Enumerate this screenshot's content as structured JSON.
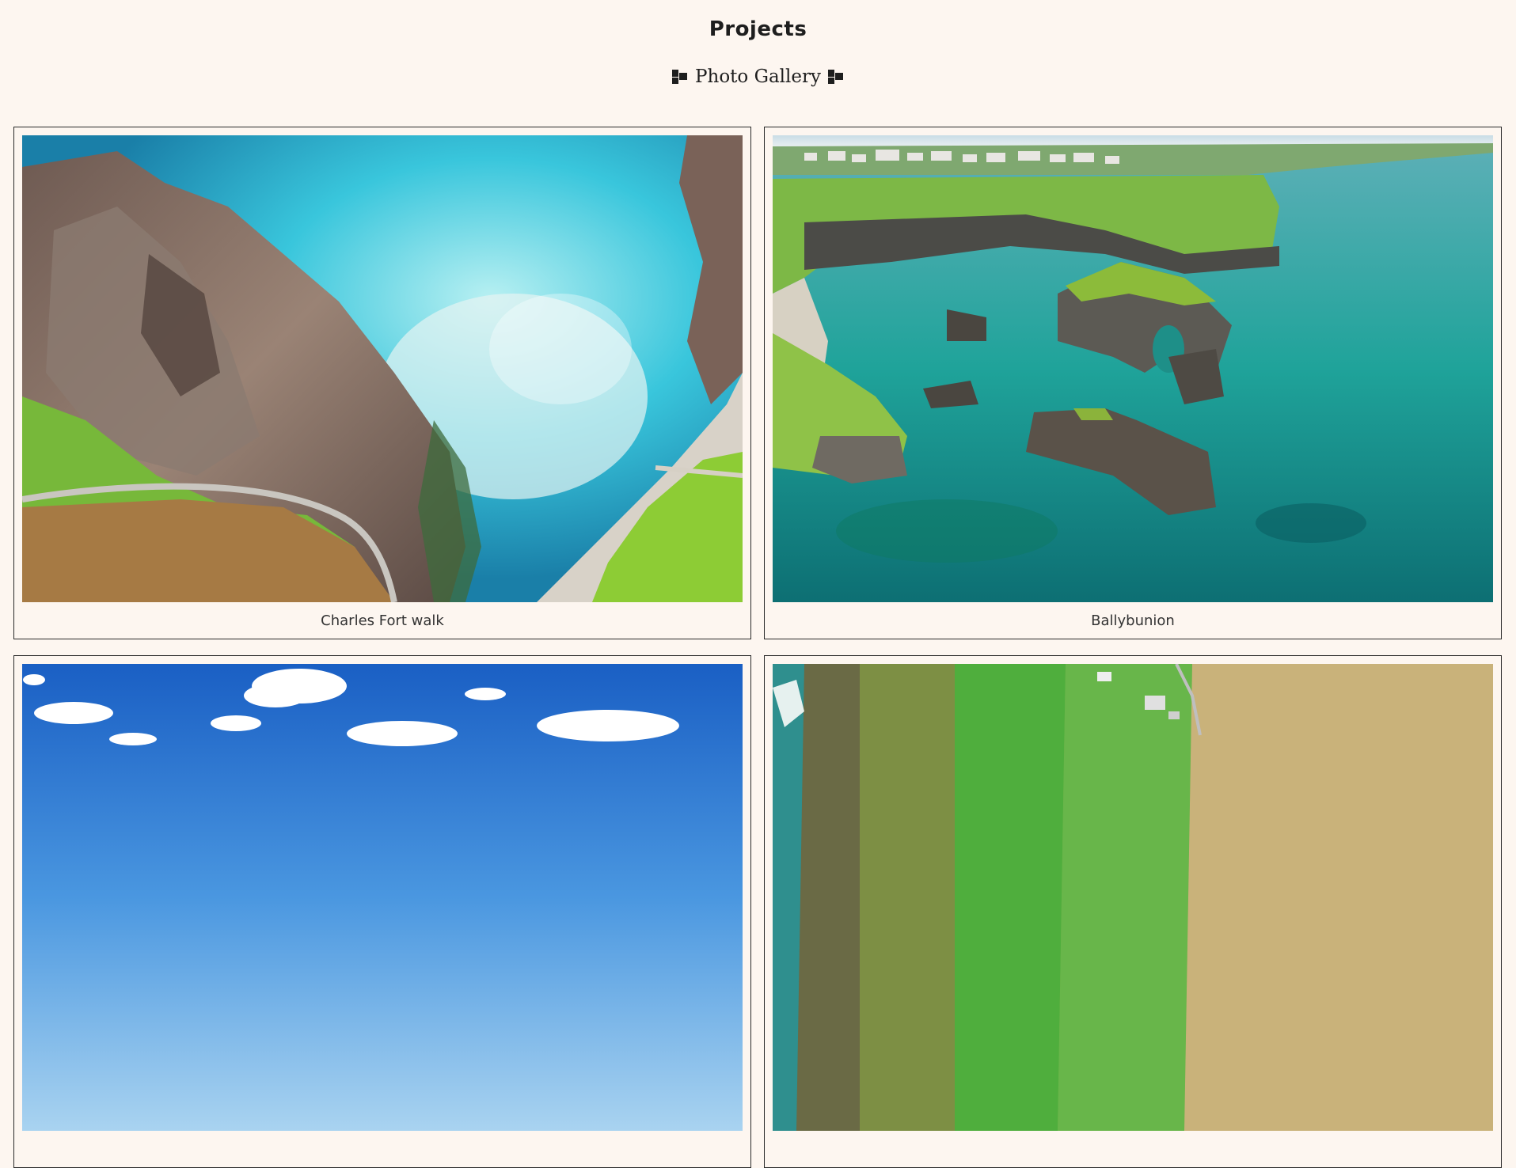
{
  "header": {
    "title": "Projects",
    "subtitle": "Photo Gallery"
  },
  "gallery": {
    "items": [
      {
        "caption": "Charles Fort walk",
        "image": "aerial-coastal-cliffs-photo"
      },
      {
        "caption": "Ballybunion",
        "image": "sea-stacks-bay-photo"
      },
      {
        "caption": "",
        "image": "blue-sky-clouds-photo"
      },
      {
        "caption": "",
        "image": "aerial-farmland-coast-photo"
      }
    ]
  }
}
